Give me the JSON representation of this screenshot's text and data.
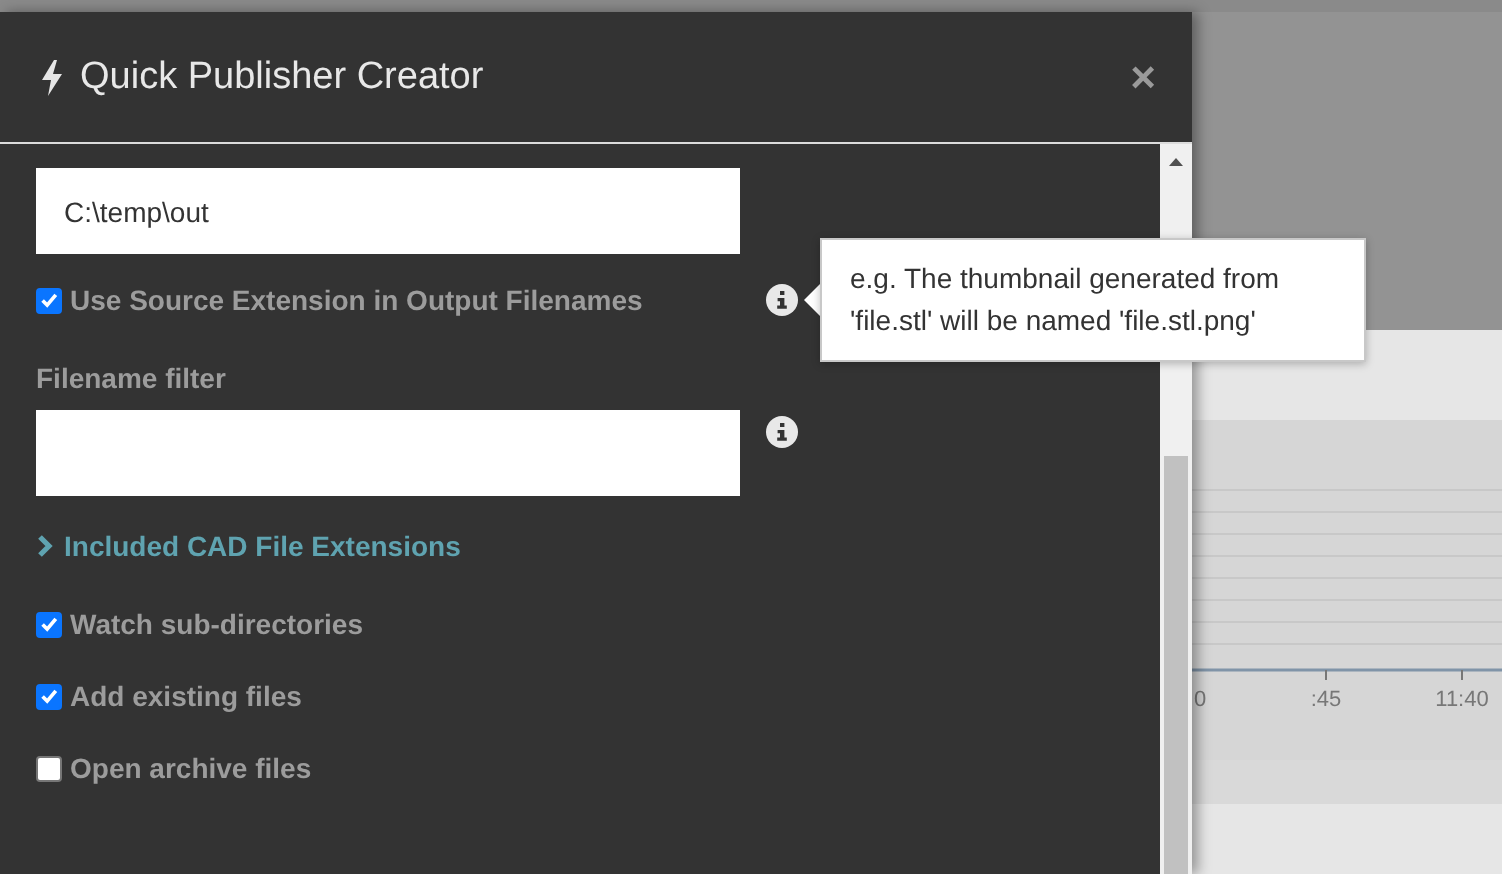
{
  "dialog": {
    "title": "Quick Publisher Creator",
    "close": "×"
  },
  "items": [
    {
      "kind": "field",
      "value": "C:\\temp\\out",
      "info": false
    },
    {
      "kind": "checkbox",
      "label": "Use Source Extension in Output Filenames",
      "checked": true,
      "info": true,
      "tooltip": "e.g. The thumbnail generated from 'file.stl' will be named 'file.stl.png'"
    },
    {
      "kind": "field",
      "label": "Filename filter",
      "info": true
    },
    {
      "kind": "expander",
      "label": "Included CAD File Extensions",
      "expanded": false
    },
    {
      "kind": "checkbox",
      "label": "Watch sub-directories",
      "checked": true,
      "info": false
    },
    {
      "kind": "checkbox",
      "label": "Add existing files",
      "checked": true,
      "info": false
    },
    {
      "kind": "checkbox",
      "label": "Open archive files",
      "checked": false,
      "info": false
    }
  ],
  "background": {
    "axis_labels": [
      "0",
      ":45",
      "11:40"
    ]
  }
}
